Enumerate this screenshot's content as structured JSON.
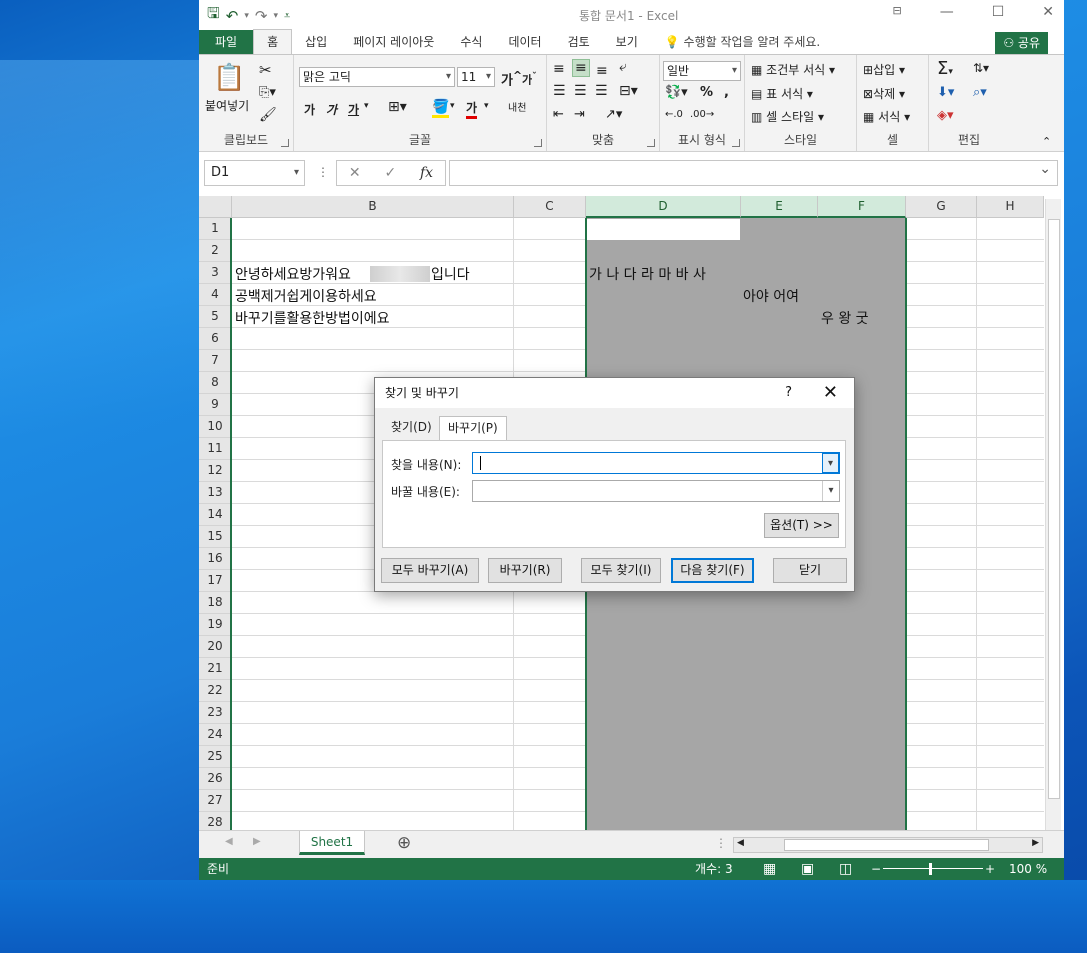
{
  "window": {
    "title": "통합 문서1 - Excel"
  },
  "ribbon": {
    "tabs": [
      "파일",
      "홈",
      "삽입",
      "페이지 레이아웃",
      "수식",
      "데이터",
      "검토",
      "보기"
    ],
    "tell_me": "수행할 작업을 알려 주세요.",
    "share": "공유",
    "clipboard": {
      "paste": "붙여넣기",
      "label": "클립보드"
    },
    "font": {
      "name": "맑은 고딕",
      "size": "11",
      "bold": "가",
      "italic": "가",
      "underline": "가",
      "label": "글꼴",
      "grow": "가",
      "shrink": "가",
      "color_a": "가",
      "phonetic": "내천"
    },
    "alignment": {
      "label": "맞춤"
    },
    "number": {
      "format": "일반",
      "label": "표시 형식"
    },
    "styles": {
      "conditional": "조건부 서식",
      "table": "표 서식",
      "cell": "셀 스타일",
      "label": "스타일"
    },
    "cells": {
      "insert": "삽입",
      "delete": "삭제",
      "format": "서식",
      "label": "셀"
    },
    "editing": {
      "label": "편집"
    }
  },
  "formula_bar": {
    "name_box": "D1",
    "fx": "fx",
    "content": ""
  },
  "grid": {
    "columns": [
      "B",
      "C",
      "D",
      "E",
      "F",
      "G",
      "H"
    ],
    "rows": [
      "1",
      "2",
      "3",
      "4",
      "5",
      "6",
      "7",
      "8",
      "9",
      "10",
      "11",
      "12",
      "13",
      "14",
      "15",
      "16",
      "17",
      "18",
      "19",
      "20",
      "21",
      "22",
      "23",
      "24",
      "25",
      "26",
      "27",
      "28"
    ],
    "cells": {
      "B3_a": "안녕하세요방가워요",
      "B3_b": "입니다",
      "B4": "공백제거쉽게이용하세요",
      "B5": "바꾸기를활용한방법이에요",
      "D3": "가 나 다 라 마 바 사",
      "E4": "아야 어여",
      "F5": "우  왕  굿"
    }
  },
  "sheet_tabs": {
    "active": "Sheet1"
  },
  "status_bar": {
    "ready": "준비",
    "count": "개수: 3",
    "zoom": "100 %"
  },
  "dialog": {
    "title": "찾기 및 바꾸기",
    "help": "?",
    "tab_find": "찾기(D)",
    "tab_replace": "바꾸기(P)",
    "find_label": "찾을 내용(N):",
    "replace_label": "바꿀 내용(E):",
    "find_value": "",
    "replace_value": "",
    "options": "옵션(T) >>",
    "replace_all": "모두 바꾸기(A)",
    "replace": "바꾸기(R)",
    "find_all": "모두 찾기(I)",
    "find_next": "다음 찾기(F)",
    "close": "닫기"
  }
}
